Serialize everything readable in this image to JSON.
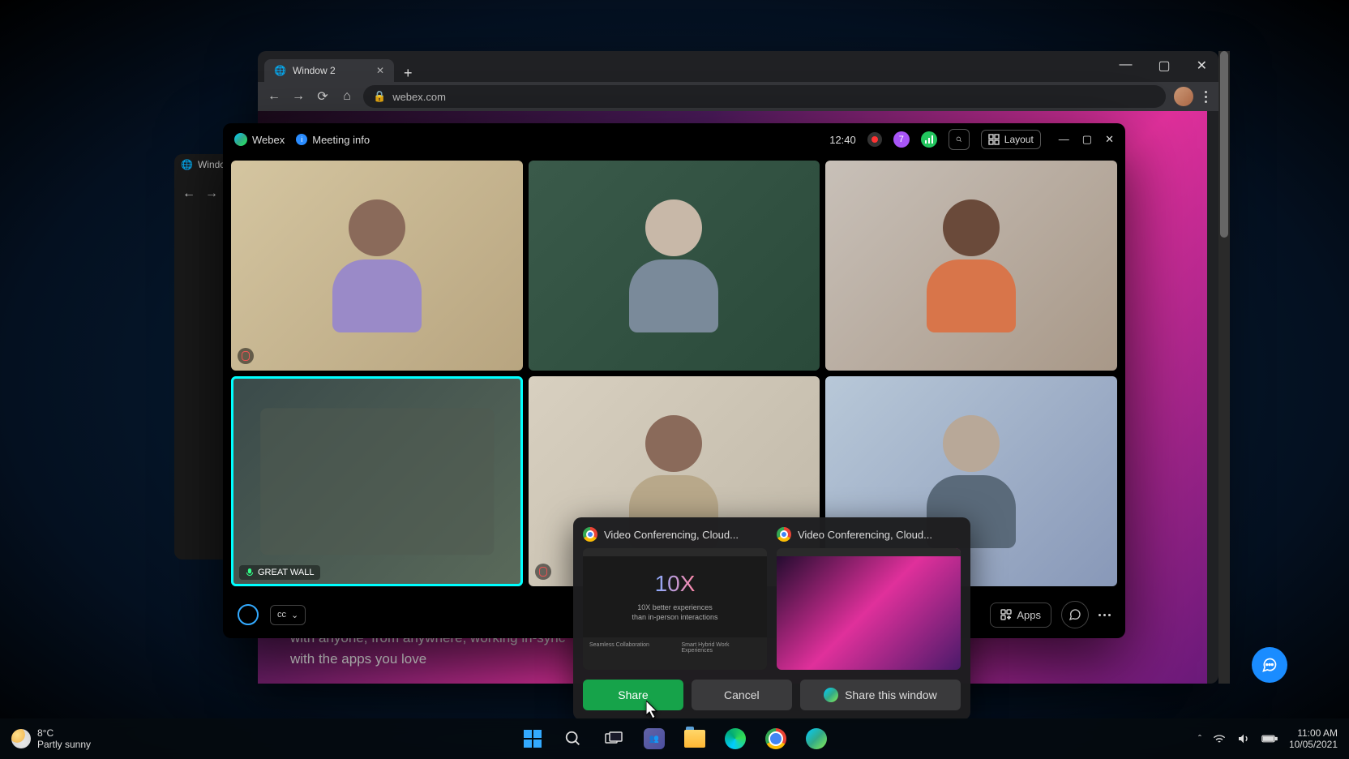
{
  "browser": {
    "tab_title": "Window 2",
    "url": "webex.com",
    "bg_tab_title": "Windo"
  },
  "page": {
    "body_line1": "with anyone, from anywhere, working in-sync",
    "body_line2": "with the apps you love"
  },
  "webex": {
    "app_name": "Webex",
    "meeting_info_label": "Meeting info",
    "time": "12:40",
    "participant_count": "7",
    "layout_label": "Layout",
    "tile_label": "GREAT WALL",
    "mute_label": "Mute",
    "apps_label": "Apps"
  },
  "share": {
    "item1_title": "Video Conferencing, Cloud...",
    "item2_title": "Video Conferencing, Cloud...",
    "thumb_big": "10X",
    "thumb_sub1": "10X better experiences",
    "thumb_sub2": "than in-person interactions",
    "thumb_foot1": "Seamless Collaboration",
    "thumb_foot2": "Smart Hybrid Work Experiences",
    "share_btn": "Share",
    "cancel_btn": "Cancel",
    "share_window_btn": "Share this window"
  },
  "taskbar": {
    "temp": "8°C",
    "weather": "Partly sunny",
    "time": "11:00 AM",
    "date": "10/05/2021"
  }
}
